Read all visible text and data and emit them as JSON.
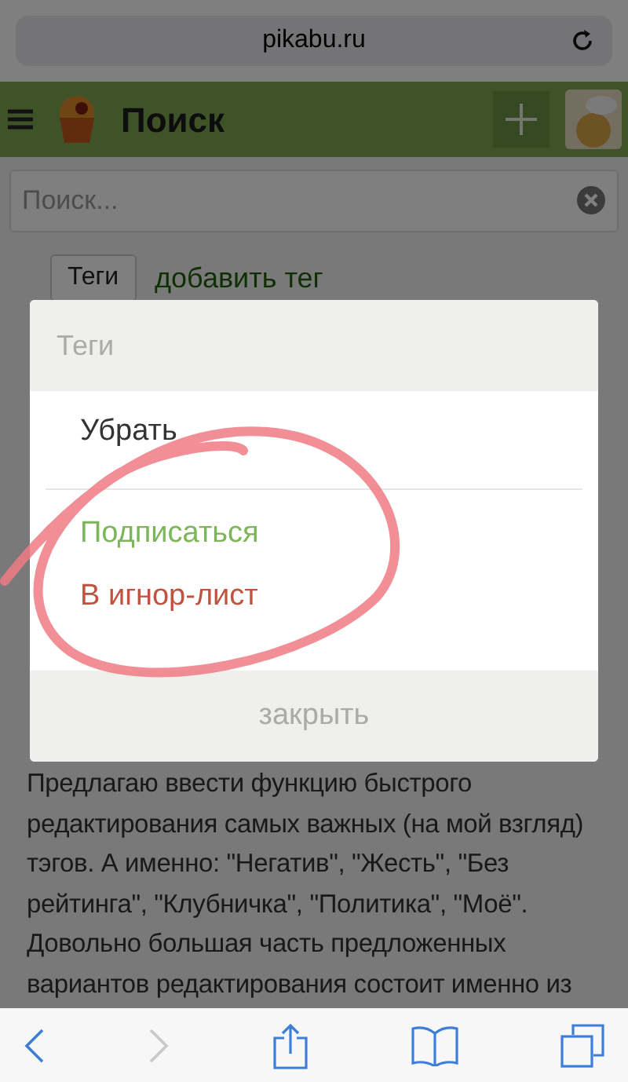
{
  "browser": {
    "url": "pikabu.ru"
  },
  "header": {
    "title": "Поиск"
  },
  "search": {
    "placeholder": "Поиск..."
  },
  "tags_row": {
    "button": "Теги",
    "link": "добавить тег"
  },
  "article": {
    "body": "Предлагаю ввести функцию быстрого редактирования самых важных (на мой взгляд) тэгов. А именно: \"Негатив\", \"Жесть\", \"Без рейтинга\", \"Клубничка\", \"Политика\", \"Моё\". Довольно большая часть предложенных вариантов редактирования состоит именно из"
  },
  "dialog": {
    "title": "Теги",
    "items": [
      {
        "label": "Убрать",
        "kind": "neutral"
      },
      {
        "label": "Подписаться",
        "kind": "subscribe"
      },
      {
        "label": "В игнор-лист",
        "kind": "ignore"
      }
    ],
    "close": "закрыть"
  }
}
